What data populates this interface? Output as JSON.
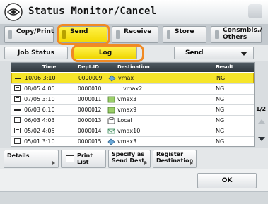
{
  "header": {
    "title": "Status Monitor/Cancel",
    "icon": "status-monitor-icon"
  },
  "tabs": [
    {
      "label": "Copy/Print"
    },
    {
      "label": "Send",
      "active": true
    },
    {
      "label": "Receive"
    },
    {
      "label": "Store"
    },
    {
      "label": "Consmbls./\nOthers"
    }
  ],
  "subbar": {
    "job_status_label": "Job Status",
    "log_label": "Log",
    "dropdown_value": "Send"
  },
  "table": {
    "columns": [
      "Time",
      "Dept.ID",
      "Destination",
      "Result"
    ],
    "rows": [
      {
        "time": "10/06 3:10",
        "dept": "0000009",
        "dest": "vmax",
        "result": "NG",
        "icon": "line-icon",
        "dest_icon": "network-icon",
        "selected": true
      },
      {
        "time": "08/05 4:05",
        "dept": "0000010",
        "dest": "vmax2",
        "result": "NG",
        "icon": "fax-icon",
        "dest_icon": ""
      },
      {
        "time": "07/05 3:10",
        "dept": "0000011",
        "dest": "vmax3",
        "result": "NG",
        "icon": "fax-icon",
        "dest_icon": "box-icon"
      },
      {
        "time": "06/03 6:10",
        "dept": "0000012",
        "dest": "vmax9",
        "result": "NG",
        "icon": "line-icon",
        "dest_icon": "box-icon"
      },
      {
        "time": "06/03 4:03",
        "dept": "0000013",
        "dest": "Local",
        "result": "NG",
        "icon": "fax-icon",
        "dest_icon": "fax-icon"
      },
      {
        "time": "05/02 4:05",
        "dept": "0000014",
        "dest": "vmax10",
        "result": "NG",
        "icon": "fax-icon",
        "dest_icon": "email-icon"
      },
      {
        "time": "05/01 3:10",
        "dept": "0000015",
        "dest": "vmax3",
        "result": "NG",
        "icon": "fax-icon",
        "dest_icon": "network-icon"
      }
    ],
    "page": "1/2"
  },
  "bottom": {
    "details": "Details",
    "print_list": "Print List",
    "specify": "Specify as\nSend Dest.",
    "register": "Register\nDestination"
  },
  "ok_label": "OK",
  "colors": {
    "highlight": "#f08a24",
    "selected": "#f6e52a",
    "header_dark": "#2f373d"
  }
}
